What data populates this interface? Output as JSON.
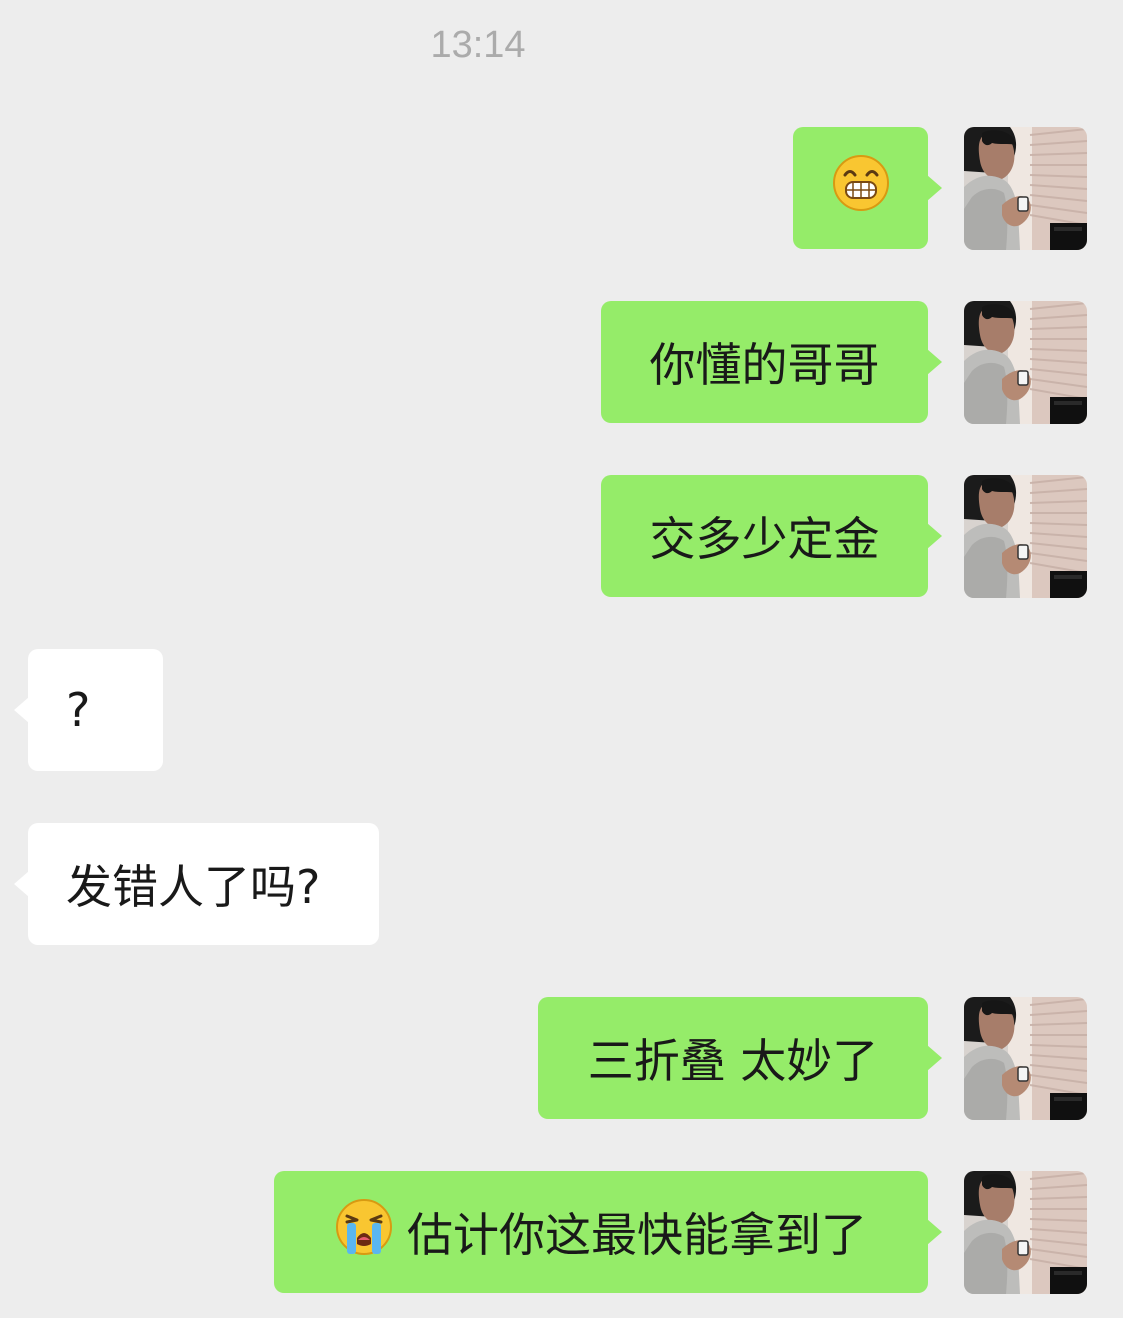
{
  "chat": {
    "timestamp": "13:14",
    "messages": [
      {
        "side": "outgoing",
        "emoji": "grinning-face",
        "text": ""
      },
      {
        "side": "outgoing",
        "text": "你懂的哥哥"
      },
      {
        "side": "outgoing",
        "text": "交多少定金"
      },
      {
        "side": "incoming",
        "text": "?"
      },
      {
        "side": "incoming",
        "text": "发错人了吗?"
      },
      {
        "side": "outgoing",
        "text": "三折叠 太妙了"
      },
      {
        "side": "outgoing",
        "emoji": "loudly-crying-face",
        "text": "估计你这最快能拿到了"
      }
    ]
  },
  "colors": {
    "background": "#EDEDED",
    "outgoing_bubble": "#95EC69",
    "incoming_bubble": "#FFFFFF",
    "timestamp_text": "#ABABAB",
    "message_text": "#191919"
  }
}
